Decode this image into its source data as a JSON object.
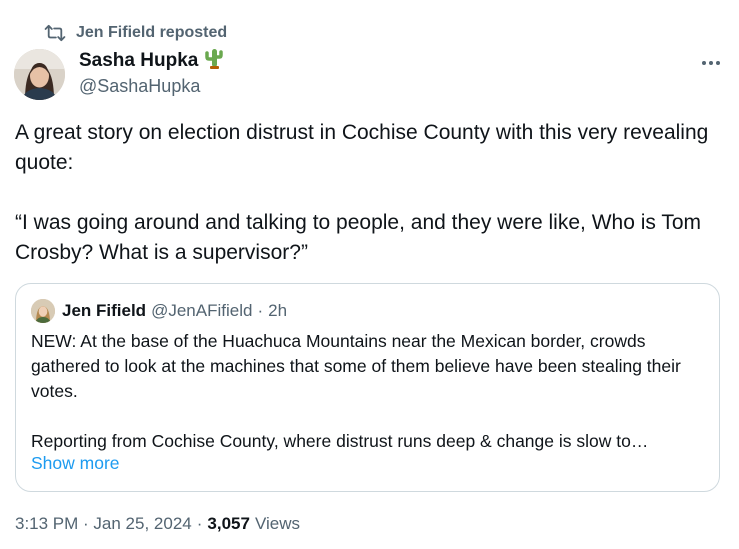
{
  "repost": {
    "icon": "repost-icon",
    "text": "Jen Fifield reposted"
  },
  "post": {
    "author": {
      "name": "Sasha Hupka",
      "handle": "@SashaHupka",
      "name_emoji_icon": "cactus-icon",
      "avatar_icon": "avatar-photo"
    },
    "more_icon": "more-horizontal-icon",
    "paragraphs": [
      "A great story on election distrust in Cochise County with this very revealing quote:",
      "“I was going around and talking to people, and they were like, Who is Tom Crosby? What is a supervisor?”"
    ],
    "timestamp": "3:13 PM · Jan 25, 2024",
    "separator": "·",
    "views_count": "3,057",
    "views_label": "Views"
  },
  "quote": {
    "author_name": "Jen Fifield",
    "author_handle": "@JenAFifield",
    "separator": "·",
    "time": "2h",
    "paragraph_1": "NEW: At the base of the Huachuca Mountains near the Mexican border, crowds gathered to look at the machines that some of them believe have been stealing their votes.",
    "paragraph_2": "Reporting from Cochise County, where distrust runs deep & change is slow to…",
    "show_more": "Show more"
  },
  "colors": {
    "text_primary": "#0f1419",
    "text_secondary": "#536471",
    "link": "#1d9bf0",
    "border": "#cfd9de"
  }
}
